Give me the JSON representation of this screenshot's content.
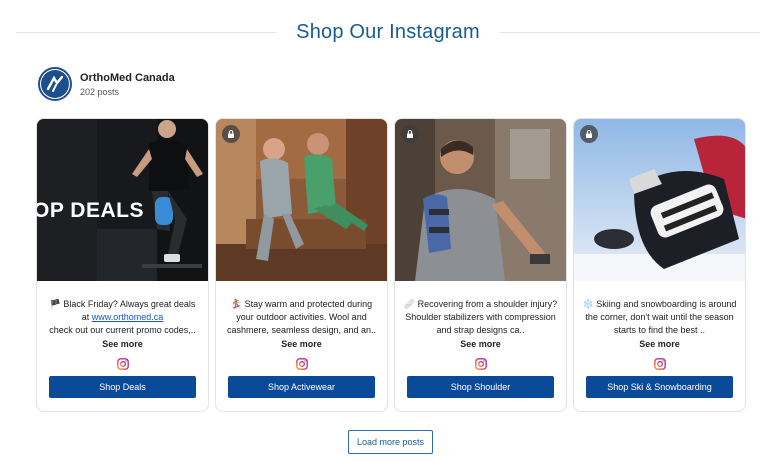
{
  "header": {
    "title": "Shop Our Instagram"
  },
  "profile": {
    "name": "OrthoMed Canada",
    "posts": "202 posts"
  },
  "cards": [
    {
      "image_text": "OP DEALS",
      "caption_parts": [
        "🏴 Black Friday? Always great deals at ",
        "www.orthomed.ca",
        " check out our current promo codes,.."
      ],
      "see_more": "See more",
      "button": "Shop Deals"
    },
    {
      "caption": "🏂 Stay warm and protected during your outdoor activities. Wool and cashmere, seamless design, and an..",
      "see_more": "See more",
      "button": "Shop Activewear"
    },
    {
      "caption": "🩹 Recovering from a shoulder injury? Shoulder stabilizers with compression and strap designs ca..",
      "see_more": "See more",
      "button": "Shop Shoulder"
    },
    {
      "caption": "❄️ Skiing and snowboarding is around the corner, don't wait until the season starts to find the best ..",
      "see_more": "See more",
      "button": "Shop Ski & Snowboarding"
    }
  ],
  "load_more": "Load more posts",
  "colors": {
    "brand_blue": "#0b4a99",
    "title_blue": "#1a5a94",
    "link": "#1a55c8"
  },
  "icons": {
    "lock": "lock-icon",
    "instagram": "instagram-icon"
  }
}
